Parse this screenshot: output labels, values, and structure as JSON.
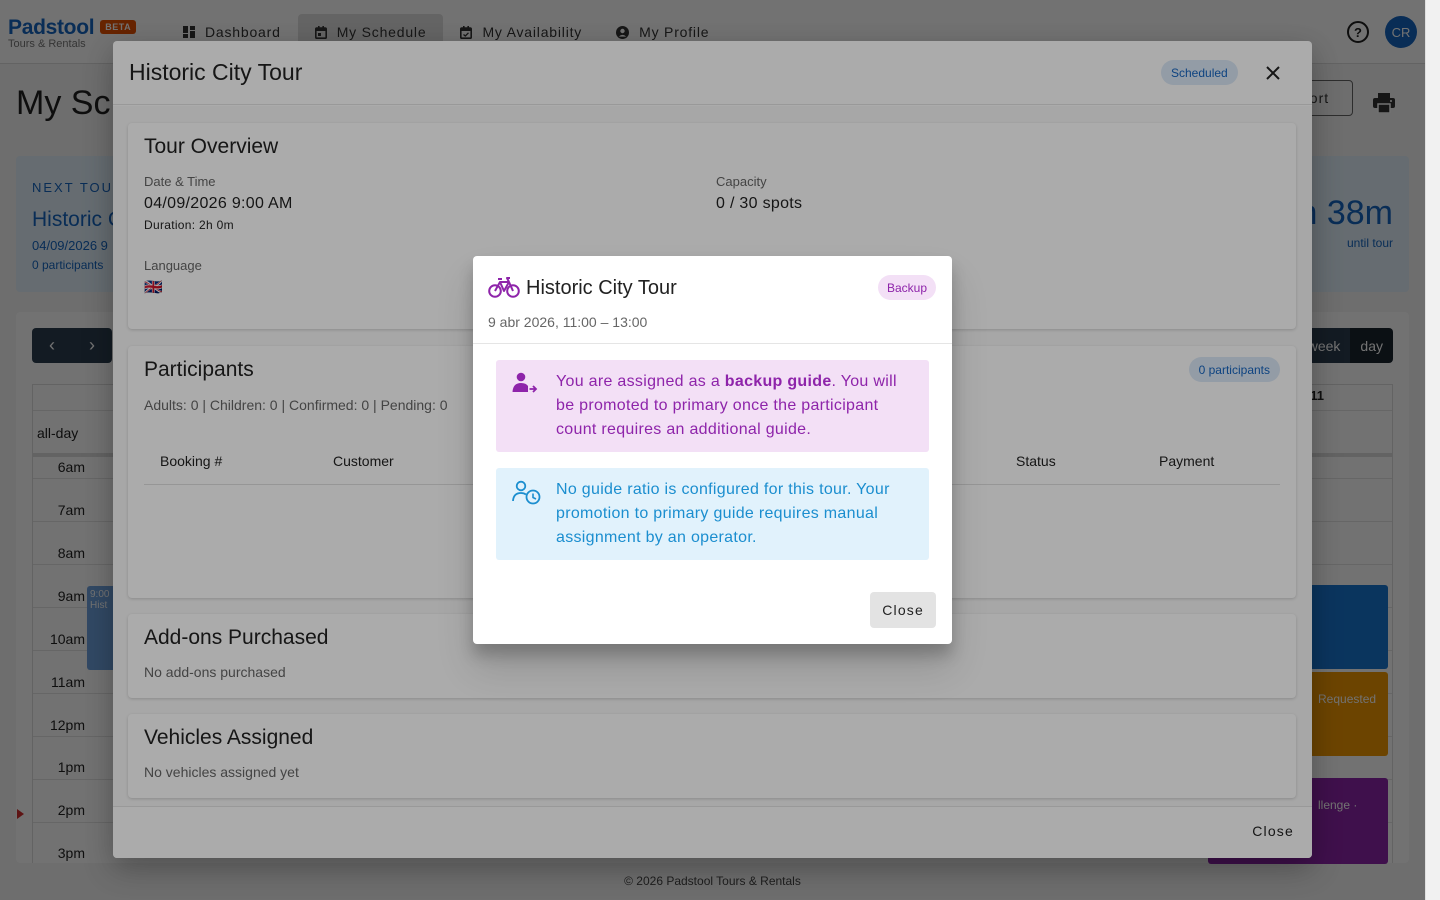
{
  "app": {
    "name": "Padstool",
    "beta": "BETA",
    "subtitle": "Tours & Rentals",
    "avatar_initials": "CR",
    "brand_color": "#1565c0"
  },
  "nav": {
    "tabs": [
      {
        "label": "Dashboard",
        "icon": "dashboard-icon"
      },
      {
        "label": "My Schedule",
        "icon": "calendar-icon",
        "active": true
      },
      {
        "label": "My Availability",
        "icon": "calendar-check-icon"
      },
      {
        "label": "My Profile",
        "icon": "account-circle-icon"
      }
    ]
  },
  "page": {
    "title": "My Sc",
    "export_label": "port"
  },
  "next_tour": {
    "label": "NEXT TOUR",
    "title": "Historic C",
    "date": "04/09/2026 9",
    "participants": "0 participants",
    "countdown": "n 38m",
    "until": "until tour"
  },
  "calendar": {
    "week_label": "week",
    "day_label": "day",
    "day_header": "11",
    "allday_label": "all-day",
    "hours": [
      "6am",
      "7am",
      "8am",
      "9am",
      "10am",
      "11am",
      "12pm",
      "1pm",
      "2pm",
      "3pm"
    ],
    "event_time": "9:00",
    "event_title": "Hist",
    "event_requested": "Requested",
    "event_challenge": "llenge ·"
  },
  "footer": "© 2026 Padstool Tours & Rentals",
  "dialog": {
    "title": "Historic City Tour",
    "status": "Scheduled",
    "overview": {
      "title": "Tour Overview",
      "date_label": "Date & Time",
      "date_value": "04/09/2026 9:00 AM",
      "duration": "Duration: 2h 0m",
      "capacity_label": "Capacity",
      "capacity_value": "0 / 30 spots",
      "language_label": "Language",
      "language_flag": "🇬🇧"
    },
    "participants": {
      "title": "Participants",
      "chip": "0 participants",
      "summary": "Adults: 0 | Children: 0 | Confirmed: 0 | Pending: 0",
      "columns": [
        "Booking #",
        "Customer",
        "Status",
        "Payment"
      ]
    },
    "addons": {
      "title": "Add-ons Purchased",
      "empty": "No add-ons purchased"
    },
    "vehicles": {
      "title": "Vehicles Assigned",
      "empty": "No vehicles assigned yet"
    },
    "close_label": "Close"
  },
  "backup_dialog": {
    "title": "Historic City Tour",
    "chip": "Backup",
    "subtitle": "9 abr 2026, 11:00 – 13:00",
    "alert_backup": {
      "before": "You are assigned as a ",
      "bold": "backup guide",
      "after": ". You will be promoted to primary once the participant count requires an additional guide."
    },
    "alert_ratio": "No guide ratio is configured for this tour. Your promotion to primary guide requires manual assignment by an operator.",
    "close_label": "Close",
    "accent_purple": "#8e24aa",
    "accent_blue": "#1b8ecf"
  }
}
